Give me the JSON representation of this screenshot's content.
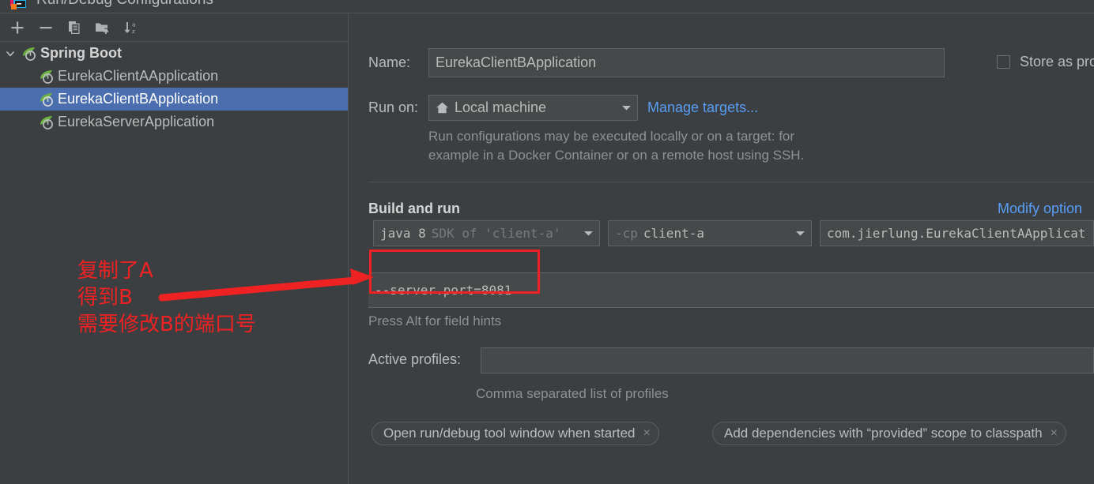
{
  "window": {
    "title": "Run/Debug Configurations",
    "icon": "idea-run-config-icon"
  },
  "left_panel": {
    "toolbar": [
      {
        "name": "add-configuration-button",
        "icon": "plus-icon",
        "label": "+"
      },
      {
        "name": "remove-configuration-button",
        "icon": "minus-icon",
        "label": "−"
      },
      {
        "name": "copy-configuration-button",
        "icon": "copy-icon",
        "label": "Copy Configuration"
      },
      {
        "name": "new-folder-button",
        "icon": "new-folder-icon",
        "label": "New Folder"
      },
      {
        "name": "sort-configurations-button",
        "icon": "sort-alpha-icon",
        "label": "Sort Configurations"
      }
    ],
    "tree": {
      "group_label": "Spring Boot",
      "items": [
        {
          "label": "EurekaClientAApplication",
          "selected": false
        },
        {
          "label": "EurekaClientBApplication",
          "selected": true
        },
        {
          "label": "EurekaServerApplication",
          "selected": false
        }
      ]
    }
  },
  "form": {
    "name_label": "Name:",
    "name_value": "EurekaClientBApplication",
    "run_on_label": "Run on:",
    "run_on_value": "Local machine",
    "run_on_icon": "home-icon",
    "manage_targets_link": "Manage targets...",
    "run_on_hint_line1": "Run configurations may be executed locally or on a target: for",
    "run_on_hint_line2": "example in a Docker Container or on a remote host using SSH.",
    "store_as_project_file_label": "Store as pro",
    "store_as_project_file_checked": false,
    "build_and_run_heading": "Build and run",
    "modify_options_link": "Modify option",
    "jre_value_prefix": "java 8",
    "jre_value_suffix": "SDK of 'client-a'",
    "classpath_value_prefix": "-cp",
    "classpath_value_suffix": "client-a",
    "main_class_value": "com.jierlung.EurekaClientAApplicat",
    "program_arguments_value": "--server.port=8081",
    "field_hint": "Press Alt for field hints",
    "active_profiles_label": "Active profiles:",
    "active_profiles_value": "",
    "active_profiles_hint": "Comma separated list of profiles",
    "chips": [
      {
        "label": "Open run/debug tool window when started",
        "close": "×"
      },
      {
        "label": "Add dependencies with “provided” scope to classpath",
        "close": "×"
      }
    ]
  },
  "annotations": {
    "color": "#ee2222",
    "lines": [
      "复制了A",
      "得到B",
      "需要修改B的端口号"
    ],
    "arrow": "red-arrow-pointing-to-program-arguments",
    "highlight_box": "program-arguments-field"
  }
}
